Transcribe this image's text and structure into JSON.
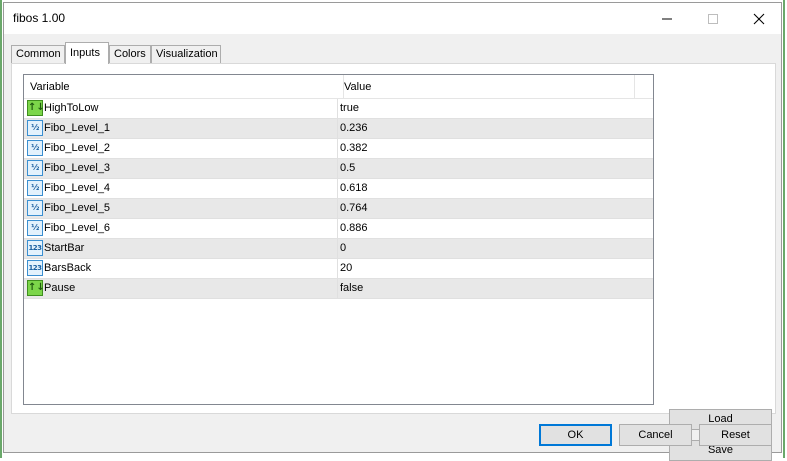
{
  "window": {
    "title": "fibos 1.00",
    "minimize_icon": "minimize-icon",
    "maximize_icon": "maximize-icon",
    "close_icon": "close-icon"
  },
  "tabs": [
    {
      "label": "Common",
      "active": false
    },
    {
      "label": "Inputs",
      "active": true
    },
    {
      "label": "Colors",
      "active": false
    },
    {
      "label": "Visualization",
      "active": false
    }
  ],
  "grid": {
    "columns": {
      "variable": "Variable",
      "value": "Value"
    },
    "rows": [
      {
        "icon": "bool-icon",
        "icon_glyph": "↑↓",
        "name": "HighToLow",
        "value": "true"
      },
      {
        "icon": "double-icon",
        "icon_glyph": "½",
        "name": "Fibo_Level_1",
        "value": "0.236"
      },
      {
        "icon": "double-icon",
        "icon_glyph": "½",
        "name": "Fibo_Level_2",
        "value": "0.382"
      },
      {
        "icon": "double-icon",
        "icon_glyph": "½",
        "name": "Fibo_Level_3",
        "value": "0.5"
      },
      {
        "icon": "double-icon",
        "icon_glyph": "½",
        "name": "Fibo_Level_4",
        "value": "0.618"
      },
      {
        "icon": "double-icon",
        "icon_glyph": "½",
        "name": "Fibo_Level_5",
        "value": "0.764"
      },
      {
        "icon": "double-icon",
        "icon_glyph": "½",
        "name": "Fibo_Level_6",
        "value": "0.886"
      },
      {
        "icon": "integer-icon",
        "icon_glyph": "123",
        "name": "StartBar",
        "value": "0"
      },
      {
        "icon": "integer-icon",
        "icon_glyph": "123",
        "name": "BarsBack",
        "value": "20"
      },
      {
        "icon": "bool-icon",
        "icon_glyph": "↑↓",
        "name": "Pause",
        "value": "false"
      }
    ]
  },
  "side_buttons": {
    "load": "Load",
    "save": "Save"
  },
  "footer_buttons": {
    "ok": "OK",
    "cancel": "Cancel",
    "reset": "Reset"
  },
  "colors": {
    "accent": "#0078d7",
    "row_alt": "#e8e8e8",
    "bool_icon": "#7cd64a",
    "numeric_icon": "#3b8fd1"
  }
}
